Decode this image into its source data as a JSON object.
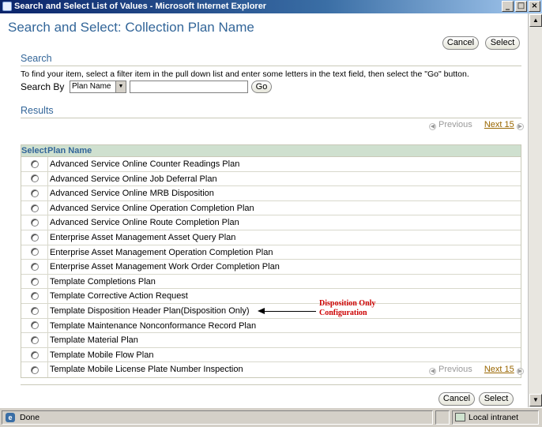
{
  "window": {
    "title": "Search and Select List of Values - Microsoft Internet Explorer",
    "minimize": "_",
    "maximize": "□",
    "close": "×"
  },
  "page": {
    "title": "Search and Select: Collection Plan Name",
    "cancel_label": "Cancel",
    "select_label": "Select"
  },
  "search": {
    "heading": "Search",
    "instructions": "To find your item, select a filter item in the pull down list and enter some letters in the text field, then select the \"Go\" button.",
    "search_by_label": "Search By",
    "filter_selected": "Plan Name",
    "text_value": "",
    "go_label": "Go"
  },
  "results": {
    "heading": "Results",
    "previous_label": "Previous",
    "next_label": "Next 15",
    "columns": {
      "select": "Select",
      "name": "Plan Name"
    },
    "rows": [
      "Advanced Service Online Counter Readings Plan",
      "Advanced Service Online Job Deferral Plan",
      "Advanced Service Online MRB Disposition",
      "Advanced Service Online Operation Completion Plan",
      "Advanced Service Online Route Completion Plan",
      "Enterprise Asset Management Asset Query Plan",
      "Enterprise Asset Management Operation Completion Plan",
      "Enterprise Asset Management Work Order Completion Plan",
      "Template Completions Plan",
      "Template Corrective Action Request",
      "Template Disposition Header Plan(Disposition Only)",
      "Template Maintenance Nonconformance Record Plan",
      "Template Material Plan",
      "Template Mobile Flow Plan",
      "Template Mobile License Plate Number Inspection"
    ]
  },
  "annotation": {
    "line1": "Disposition Only",
    "line2": "Configuration"
  },
  "status": {
    "left": "Done",
    "zone": "Local intranet"
  }
}
